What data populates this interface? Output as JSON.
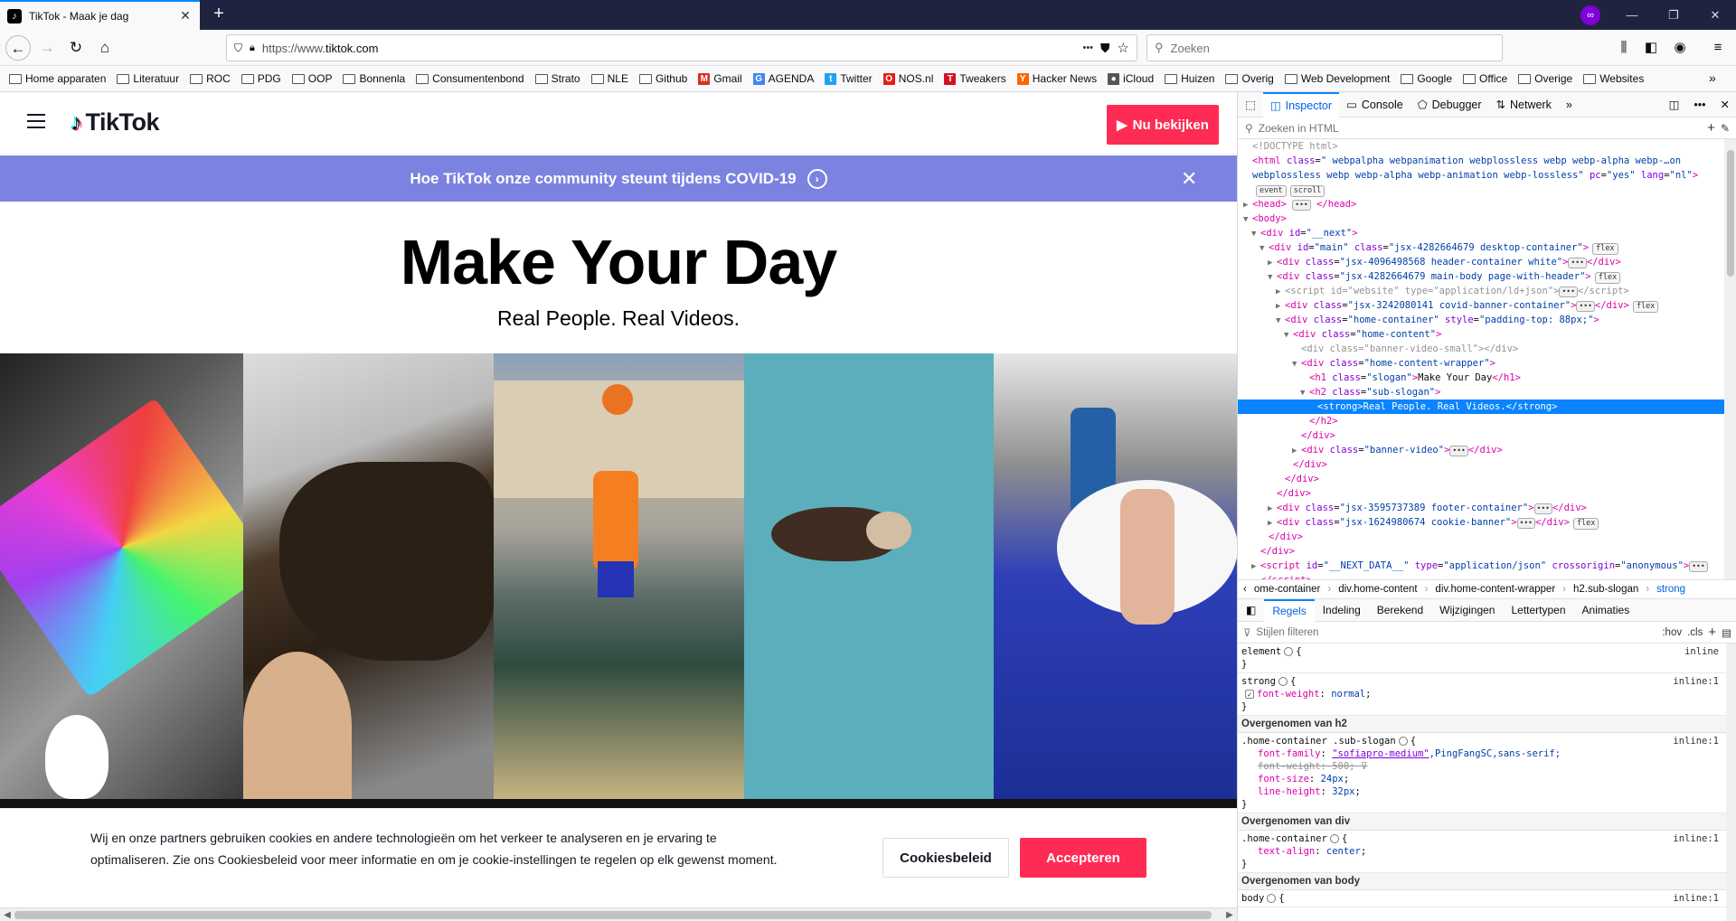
{
  "browser": {
    "tab_title": "TikTok - Maak je dag",
    "url_prefix": "https://www.",
    "url_domain": "tiktok.com",
    "url_dots": "•••",
    "search_placeholder": "Zoeken",
    "private_icon": "mask-icon"
  },
  "bookmarks": [
    {
      "label": "Home apparaten",
      "icon": "folder"
    },
    {
      "label": "Literatuur",
      "icon": "folder"
    },
    {
      "label": "ROC",
      "icon": "folder"
    },
    {
      "label": "PDG",
      "icon": "folder"
    },
    {
      "label": "OOP",
      "icon": "folder"
    },
    {
      "label": "Bonnenla",
      "icon": "folder"
    },
    {
      "label": "Consumentenbond",
      "icon": "folder"
    },
    {
      "label": "Strato",
      "icon": "folder"
    },
    {
      "label": "NLE",
      "icon": "folder"
    },
    {
      "label": "Github",
      "icon": "folder"
    },
    {
      "label": "Gmail",
      "icon": "gmail",
      "color": "#d93025",
      "glyph": "M"
    },
    {
      "label": "AGENDA",
      "icon": "google",
      "color": "#4285f4",
      "glyph": "G"
    },
    {
      "label": "Twitter",
      "icon": "twitter",
      "color": "#1da1f2",
      "glyph": "t"
    },
    {
      "label": "NOS.nl",
      "icon": "nos",
      "color": "#e61e14",
      "glyph": "O"
    },
    {
      "label": "Tweakers",
      "icon": "tweakers",
      "color": "#d7101f",
      "glyph": "T"
    },
    {
      "label": "Hacker News",
      "icon": "hackernews",
      "color": "#ff6600",
      "glyph": "Y"
    },
    {
      "label": "iCloud",
      "icon": "apple",
      "color": "#555555",
      "glyph": "●"
    },
    {
      "label": "Huizen",
      "icon": "folder"
    },
    {
      "label": "Overig",
      "icon": "folder"
    },
    {
      "label": "Web Development",
      "icon": "folder"
    },
    {
      "label": "Google",
      "icon": "folder"
    },
    {
      "label": "Office",
      "icon": "folder"
    },
    {
      "label": "Overige",
      "icon": "folder"
    },
    {
      "label": "Websites",
      "icon": "folder"
    }
  ],
  "tiktok": {
    "logo_text": "TikTok",
    "watch_button": "Nu bekijken",
    "covid_banner": "Hoe TikTok onze community steunt tijdens COVID-19",
    "slogan": "Make Your Day",
    "sub_slogan": "Real People. Real Videos.",
    "cookie_text": "Wij en onze partners gebruiken cookies en andere technologieën om het verkeer te analyseren en je ervaring te optimaliseren. Zie ons Cookiesbeleid voor meer informatie en om je cookie-instellingen te regelen op elk gewenst moment.",
    "cookie_policy_button": "Cookiesbeleid",
    "accept_button": "Accepteren",
    "brand_color": "#fe2c55",
    "banner_color": "#7c82e0"
  },
  "devtools": {
    "tabs": [
      "Inspector",
      "Console",
      "Debugger",
      "Netwerk"
    ],
    "search_placeholder": "Zoeken in HTML",
    "markup": [
      {
        "indent": 0,
        "tw": "",
        "html": "<span class='cm'>&lt;!DOCTYPE html&gt;</span>"
      },
      {
        "indent": 0,
        "tw": "",
        "html": "<span class='tag'>&lt;html</span> <span class='an'>class</span>=<span class='av'>\" webpalpha webpanimation webplossless webp webp-alpha webp-…on</span>"
      },
      {
        "indent": 0,
        "tw": "",
        "html": "<span class='av'>webplossless webp webp-alpha webp-animation webp-lossless\"</span> <span class='an'>pc</span>=<span class='av'>\"yes\"</span> <span class='an'>lang</span>=<span class='av'>\"nl\"</span><span class='tag'>&gt;</span>"
      },
      {
        "indent": 0,
        "tw": "",
        "html": "<span class='badge'>event</span><span class='badge'>scroll</span>"
      },
      {
        "indent": 0,
        "tw": "▶",
        "html": "<span class='tag'>&lt;head&gt;</span> <span class='dots'>•••</span> <span class='tag'>&lt;/head&gt;</span>"
      },
      {
        "indent": 0,
        "tw": "▼",
        "html": "<span class='tag'>&lt;body&gt;</span>"
      },
      {
        "indent": 1,
        "tw": "▼",
        "html": "<span class='tag'>&lt;div</span> <span class='an'>id</span>=<span class='av'>\"__next\"</span><span class='tag'>&gt;</span>"
      },
      {
        "indent": 2,
        "tw": "▼",
        "html": "<span class='tag'>&lt;div</span> <span class='an'>id</span>=<span class='av'>\"main\"</span> <span class='an'>class</span>=<span class='av'>\"jsx-4282664679 desktop-container\"</span><span class='tag'>&gt;</span><span class='badge'>flex</span>"
      },
      {
        "indent": 3,
        "tw": "▶",
        "html": "<span class='tag'>&lt;div</span> <span class='an'>class</span>=<span class='av'>\"jsx-4096498568 header-container white\"</span><span class='tag'>&gt;</span><span class='dots'>•••</span><span class='tag'>&lt;/div&gt;</span>"
      },
      {
        "indent": 3,
        "tw": "▼",
        "html": "<span class='tag'>&lt;div</span> <span class='an'>class</span>=<span class='av'>\"jsx-4282664679 main-body page-with-header\"</span><span class='tag'>&gt;</span><span class='badge'>flex</span>"
      },
      {
        "indent": 4,
        "tw": "▶",
        "html": "<span class='cm'>&lt;script id=\"website\" type=\"application/ld+json\"&gt;</span><span class='dots'>•••</span><span class='cm'>&lt;/script&gt;</span>"
      },
      {
        "indent": 4,
        "tw": "▶",
        "html": "<span class='tag'>&lt;div</span> <span class='an'>class</span>=<span class='av'>\"jsx-3242080141 covid-banner-container\"</span><span class='tag'>&gt;</span><span class='dots'>•••</span><span class='tag'>&lt;/div&gt;</span><span class='badge'>flex</span>"
      },
      {
        "indent": 4,
        "tw": "▼",
        "html": "<span class='tag'>&lt;div</span> <span class='an'>class</span>=<span class='av'>\"home-container\"</span> <span class='an'>style</span>=<span class='av'>\"padding-top: 88px;\"</span><span class='tag'>&gt;</span>"
      },
      {
        "indent": 5,
        "tw": "▼",
        "html": "<span class='tag'>&lt;div</span> <span class='an'>class</span>=<span class='av'>\"home-content\"</span><span class='tag'>&gt;</span>"
      },
      {
        "indent": 6,
        "tw": "",
        "html": "<span class='cm'>&lt;div class=\"banner-video-small\"&gt;&lt;/div&gt;</span>"
      },
      {
        "indent": 6,
        "tw": "▼",
        "html": "<span class='tag'>&lt;div</span> <span class='an'>class</span>=<span class='av'>\"home-content-wrapper\"</span><span class='tag'>&gt;</span>"
      },
      {
        "indent": 7,
        "tw": "",
        "html": "<span class='tag'>&lt;h1</span> <span class='an'>class</span>=<span class='av'>\"slogan\"</span><span class='tag'>&gt;</span>Make Your Day<span class='tag'>&lt;/h1&gt;</span>"
      },
      {
        "indent": 7,
        "tw": "▼",
        "html": "<span class='tag'>&lt;h2</span> <span class='an'>class</span>=<span class='av'>\"sub-slogan\"</span><span class='tag'>&gt;</span>"
      },
      {
        "indent": 8,
        "tw": "",
        "html": "<span class='tag'>&lt;strong&gt;</span>Real People. Real Videos.<span class='tag'>&lt;/strong&gt;</span>",
        "selected": true
      },
      {
        "indent": 7,
        "tw": "",
        "html": "<span class='tag'>&lt;/h2&gt;</span>"
      },
      {
        "indent": 6,
        "tw": "",
        "html": "<span class='tag'>&lt;/div&gt;</span>"
      },
      {
        "indent": 6,
        "tw": "▶",
        "html": "<span class='tag'>&lt;div</span> <span class='an'>class</span>=<span class='av'>\"banner-video\"</span><span class='tag'>&gt;</span><span class='dots'>•••</span><span class='tag'>&lt;/div&gt;</span>"
      },
      {
        "indent": 5,
        "tw": "",
        "html": "<span class='tag'>&lt;/div&gt;</span>"
      },
      {
        "indent": 4,
        "tw": "",
        "html": "<span class='tag'>&lt;/div&gt;</span>"
      },
      {
        "indent": 3,
        "tw": "",
        "html": "<span class='tag'>&lt;/div&gt;</span>"
      },
      {
        "indent": 3,
        "tw": "▶",
        "html": "<span class='tag'>&lt;div</span> <span class='an'>class</span>=<span class='av'>\"jsx-3595737389 footer-container\"</span><span class='tag'>&gt;</span><span class='dots'>•••</span><span class='tag'>&lt;/div&gt;</span>"
      },
      {
        "indent": 3,
        "tw": "▶",
        "html": "<span class='tag'>&lt;div</span> <span class='an'>class</span>=<span class='av'>\"jsx-1624980674 cookie-banner\"</span><span class='tag'>&gt;</span><span class='dots'>•••</span><span class='tag'>&lt;/div&gt;</span><span class='badge'>flex</span>"
      },
      {
        "indent": 2,
        "tw": "",
        "html": "<span class='tag'>&lt;/div&gt;</span>"
      },
      {
        "indent": 1,
        "tw": "",
        "html": "<span class='tag'>&lt;/div&gt;</span>"
      },
      {
        "indent": 1,
        "tw": "▶",
        "html": "<span class='tag'>&lt;script</span> <span class='an'>id</span>=<span class='av'>\"__NEXT_DATA__\"</span> <span class='an'>type</span>=<span class='av'>\"application/json\"</span> <span class='an'>crossorigin</span>=<span class='av'>\"anonymous\"</span><span class='tag'>&gt;</span><span class='dots'>•••</span>"
      },
      {
        "indent": 1,
        "tw": "",
        "html": "<span class='tag'>&lt;/script&gt;</span>"
      }
    ],
    "breadcrumbs": [
      "ome-container",
      "div.home-content",
      "div.home-content-wrapper",
      "h2.sub-slogan",
      "strong"
    ],
    "rule_tabs": [
      "Regels",
      "Indeling",
      "Berekend",
      "Wijzigingen",
      "Lettertypen",
      "Animaties"
    ],
    "filter_placeholder": "Stijlen filteren",
    "filter_hov": ":hov",
    "filter_cls": ".cls",
    "rules": {
      "element_selector": "element",
      "element_source": "inline",
      "strong_selector": "strong",
      "strong_source": "inline:1",
      "strong_prop": "font-weight",
      "strong_val": "normal",
      "inherit_h2": "Overgenomen van h2",
      "sub_selector": ".home-container .sub-slogan",
      "sub_source": "inline:1",
      "ff_prop": "font-family",
      "ff_link": "\"sofiapro-medium\"",
      "ff_rest": ",PingFangSC,sans-serif;",
      "fw_prop": "font-weight",
      "fw_val": "500",
      "fs_prop": "font-size",
      "fs_val": "24px",
      "lh_prop": "line-height",
      "lh_val": "32px",
      "inherit_div": "Overgenomen van div",
      "hc_selector": ".home-container",
      "hc_source": "inline:1",
      "ta_prop": "text-align",
      "ta_val": "center",
      "inherit_body": "Overgenomen van body",
      "body_selector": "body",
      "body_source": "inline:1"
    }
  }
}
